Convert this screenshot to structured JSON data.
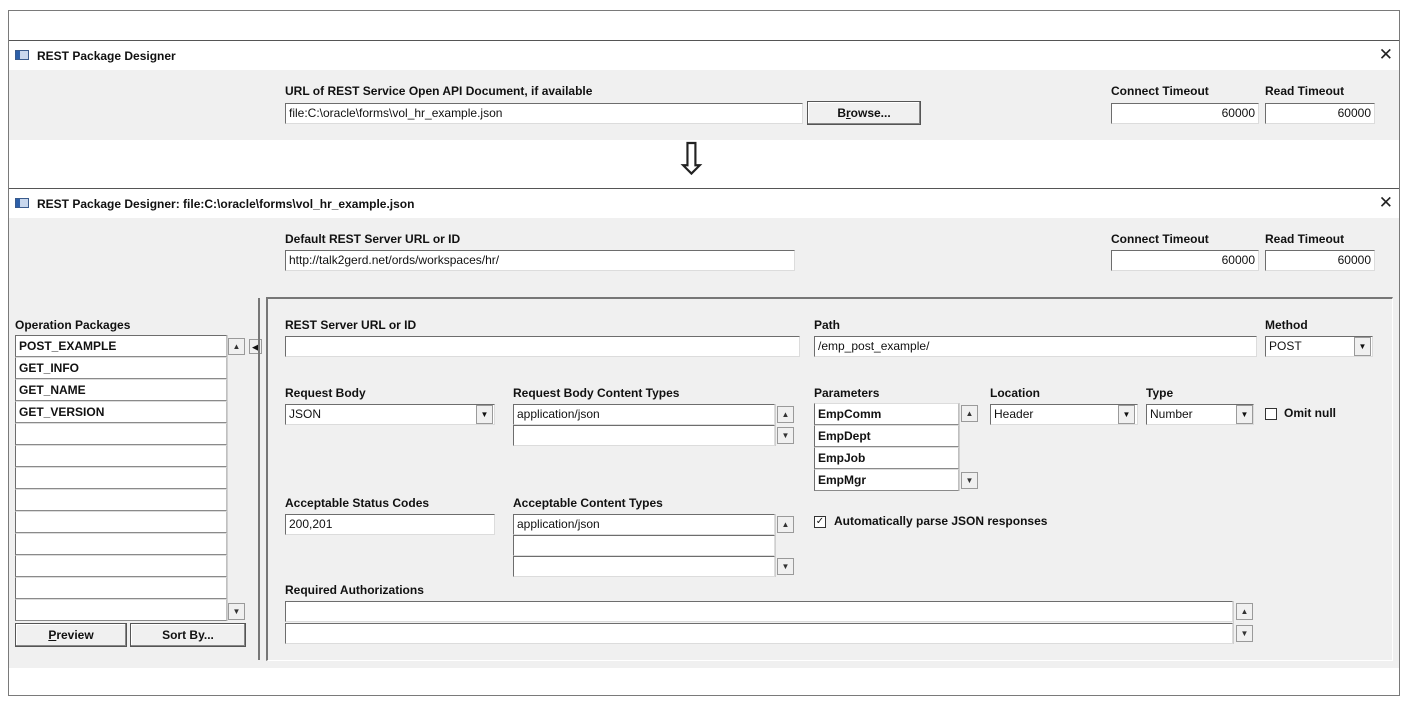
{
  "top_window": {
    "title": "REST Package Designer",
    "close": "✕",
    "url_label": "URL of REST Service Open API Document, if available",
    "url_value": "file:C:\\oracle\\forms\\vol_hr_example.json",
    "browse_label_pre": "B",
    "browse_label_ul": "r",
    "browse_label_post": "owse...",
    "connect_timeout_label": "Connect Timeout",
    "connect_timeout_value": "60000",
    "read_timeout_label": "Read Timeout",
    "read_timeout_value": "60000"
  },
  "transition_arrow": "⇩",
  "main_window": {
    "title": "REST Package Designer: file:C:\\oracle\\forms\\vol_hr_example.json",
    "close": "✕",
    "default_url_label": "Default REST Server URL or ID",
    "default_url_value": "http://talk2gerd.net/ords/workspaces/hr/",
    "connect_timeout_label": "Connect Timeout",
    "connect_timeout_value": "60000",
    "read_timeout_label": "Read Timeout",
    "read_timeout_value": "60000"
  },
  "operation_packages": {
    "label": "Operation Packages",
    "items": [
      "POST_EXAMPLE",
      "GET_INFO",
      "GET_NAME",
      "GET_VERSION",
      "",
      "",
      "",
      "",
      "",
      "",
      "",
      "",
      ""
    ],
    "preview_ul": "P",
    "preview_rest": "review",
    "sort_label": "Sort By..."
  },
  "detail": {
    "rest_server_label": "REST Server URL or ID",
    "rest_server_value": "",
    "path_label": "Path",
    "path_value": "/emp_post_example/",
    "method_label": "Method",
    "method_value": "POST",
    "request_body_label": "Request Body",
    "request_body_value": "JSON",
    "req_content_types_label": "Request Body Content Types",
    "req_content_types": [
      "application/json",
      ""
    ],
    "parameters_label": "Parameters",
    "parameters": [
      "EmpComm",
      "EmpDept",
      "EmpJob",
      "EmpMgr"
    ],
    "location_label": "Location",
    "location_value": "Header",
    "type_label": "Type",
    "type_value": "Number",
    "omit_null_label": "Omit null",
    "omit_null_checked": false,
    "status_codes_label": "Acceptable Status Codes",
    "status_codes_value": "200,201",
    "acc_content_types_label": "Acceptable Content Types",
    "acc_content_types": [
      "application/json",
      "",
      ""
    ],
    "auto_parse_label": "Automatically parse JSON responses",
    "auto_parse_checked": true,
    "check_mark": "✓",
    "required_auth_label": "Required Authorizations",
    "required_auth": [
      "",
      ""
    ]
  },
  "glyphs": {
    "up": "▲",
    "down": "▼",
    "left": "◀"
  }
}
